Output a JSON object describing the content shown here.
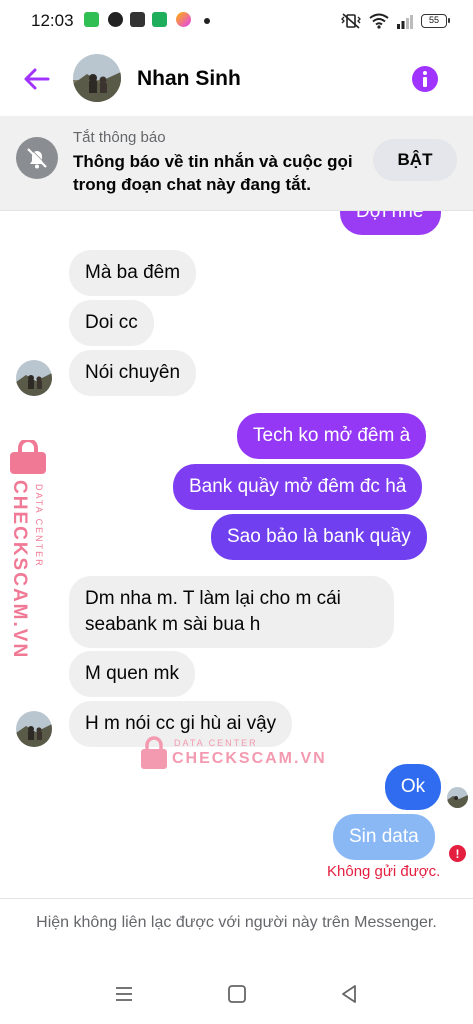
{
  "status_bar": {
    "time": "12:03",
    "battery": "55",
    "notification_icons": [
      "messages-icon",
      "messenger-icon",
      "shopping-bag-icon",
      "store-icon",
      "star-app-icon"
    ]
  },
  "header": {
    "contact_name": "Nhan Sinh",
    "accent_color": "#a033ff"
  },
  "mute_banner": {
    "small_label": "Tắt thông báo",
    "message": "Thông báo về tin nhắn và cuộc gọi trong đoạn chat này đang tắt.",
    "button_label": "BẬT"
  },
  "messages": {
    "m0": "Đợi nhé",
    "m1": "Mà ba đêm",
    "m2": "Doi cc",
    "m3": "Nói chuyên",
    "m4": "Tech ko mở đêm à",
    "m5": "Bank quầy mở đêm đc hả",
    "m6": "Sao bảo là bank quầy",
    "m7": "Dm nha m. T làm lại cho m cái seabank m sài bua h",
    "m8": "M quen mk",
    "m9": "H m nói cc gi hù ai vậy",
    "m10": "Ok",
    "m11": "Sin data",
    "error_text": "Không gửi được."
  },
  "colors": {
    "outgoing_purple": "#9b3cf5",
    "outgoing_violet": "#7a3df0",
    "outgoing_blue": "#2f6cf0",
    "failed_bubble": "#8ab8f5",
    "incoming": "#efefef",
    "error_red": "#e41e3f",
    "watermark_pink": "#f07a96"
  },
  "watermark": {
    "side_main": "CHECKSCAM.VN",
    "side_sub": "DATA CENTER",
    "center_main": "CHECKSCAM.VN",
    "center_sub": "DATA CENTER"
  },
  "footer": {
    "text": "Hiện không liên lạc được với người này trên Messenger."
  }
}
